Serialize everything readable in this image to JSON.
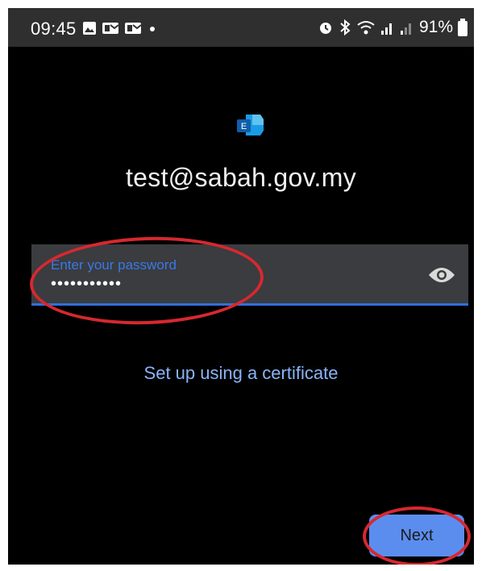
{
  "status_bar": {
    "time": "09:45",
    "battery": "91%",
    "icons_left": [
      "image-icon",
      "mail-icon",
      "mail-icon",
      "dot-icon"
    ],
    "icons_right": [
      "alarm-icon",
      "bluetooth-icon",
      "wifi-icon",
      "signal-icon",
      "signal-weak-icon",
      "battery-icon"
    ]
  },
  "app": {
    "icon": "exchange-icon",
    "icon_letter": "E"
  },
  "account": {
    "email": "test@sabah.gov.my"
  },
  "password_field": {
    "label": "Enter your password",
    "value_masked": "•••••••••••",
    "toggle_icon": "eye-icon"
  },
  "links": {
    "certificate": "Set up using a certificate"
  },
  "buttons": {
    "next": "Next"
  },
  "colors": {
    "background": "#000000",
    "status_bar": "#2f2f2f",
    "field_bg": "#3a3c3f",
    "accent": "#3b78e7",
    "link": "#8ab4f8",
    "button": "#5b8def",
    "annotation": "#d7282f"
  }
}
